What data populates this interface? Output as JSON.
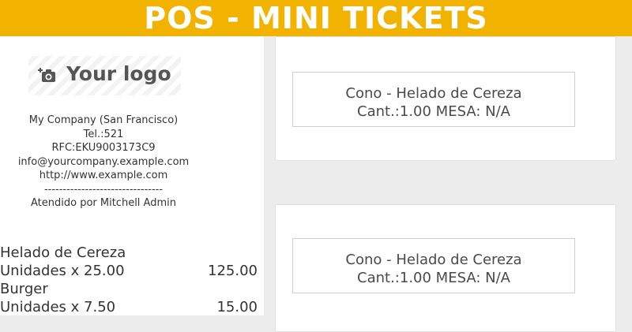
{
  "header": {
    "title": "POS - MINI TICKETS"
  },
  "receipt": {
    "logo": {
      "icon": "camera-icon",
      "text": "Your logo"
    },
    "company_lines": [
      "My Company (San Francisco)",
      "Tel.:521",
      "RFC:EKU9003173C9",
      "info@yourcompany.example.com",
      "http://www.example.com",
      "--------------------------------",
      "Atendido por Mitchell Admin"
    ],
    "items": [
      {
        "name": "Helado de Cereza",
        "detail": "Unidades x 25.00",
        "amount": "125.00"
      },
      {
        "name": "Burger",
        "detail": "Unidades x 7.50",
        "amount": "15.00"
      }
    ]
  },
  "tickets": [
    {
      "product": "Cono - Helado de Cereza",
      "info": "Cant.:1.00 MESA: N/A"
    },
    {
      "product": "Cono - Helado de Cereza",
      "info": "Cant.:1.00 MESA: N/A"
    }
  ],
  "colors": {
    "banner": "#f1b300",
    "background": "#ececec"
  }
}
